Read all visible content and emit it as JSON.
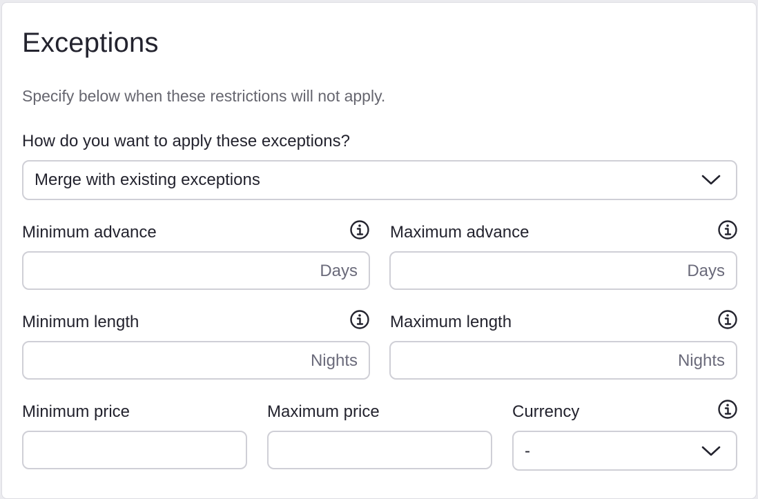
{
  "panel": {
    "title": "Exceptions",
    "description": "Specify below when these restrictions will not apply."
  },
  "apply_mode": {
    "label": "How do you want to apply these exceptions?",
    "selected": "Merge with existing exceptions"
  },
  "min_advance": {
    "label": "Minimum advance",
    "value": "",
    "suffix": "Days",
    "icon": "info-icon"
  },
  "max_advance": {
    "label": "Maximum advance",
    "value": "",
    "suffix": "Days",
    "icon": "info-icon"
  },
  "min_length": {
    "label": "Minimum length",
    "value": "",
    "suffix": "Nights",
    "icon": "info-icon"
  },
  "max_length": {
    "label": "Maximum length",
    "value": "",
    "suffix": "Nights",
    "icon": "info-icon"
  },
  "min_price": {
    "label": "Minimum price",
    "value": ""
  },
  "max_price": {
    "label": "Maximum price",
    "value": ""
  },
  "currency": {
    "label": "Currency",
    "selected": "-",
    "icon": "info-icon"
  },
  "colors": {
    "text": "#23232e",
    "muted": "#66666f",
    "border": "#cfcfd6",
    "background": "#ffffff"
  }
}
